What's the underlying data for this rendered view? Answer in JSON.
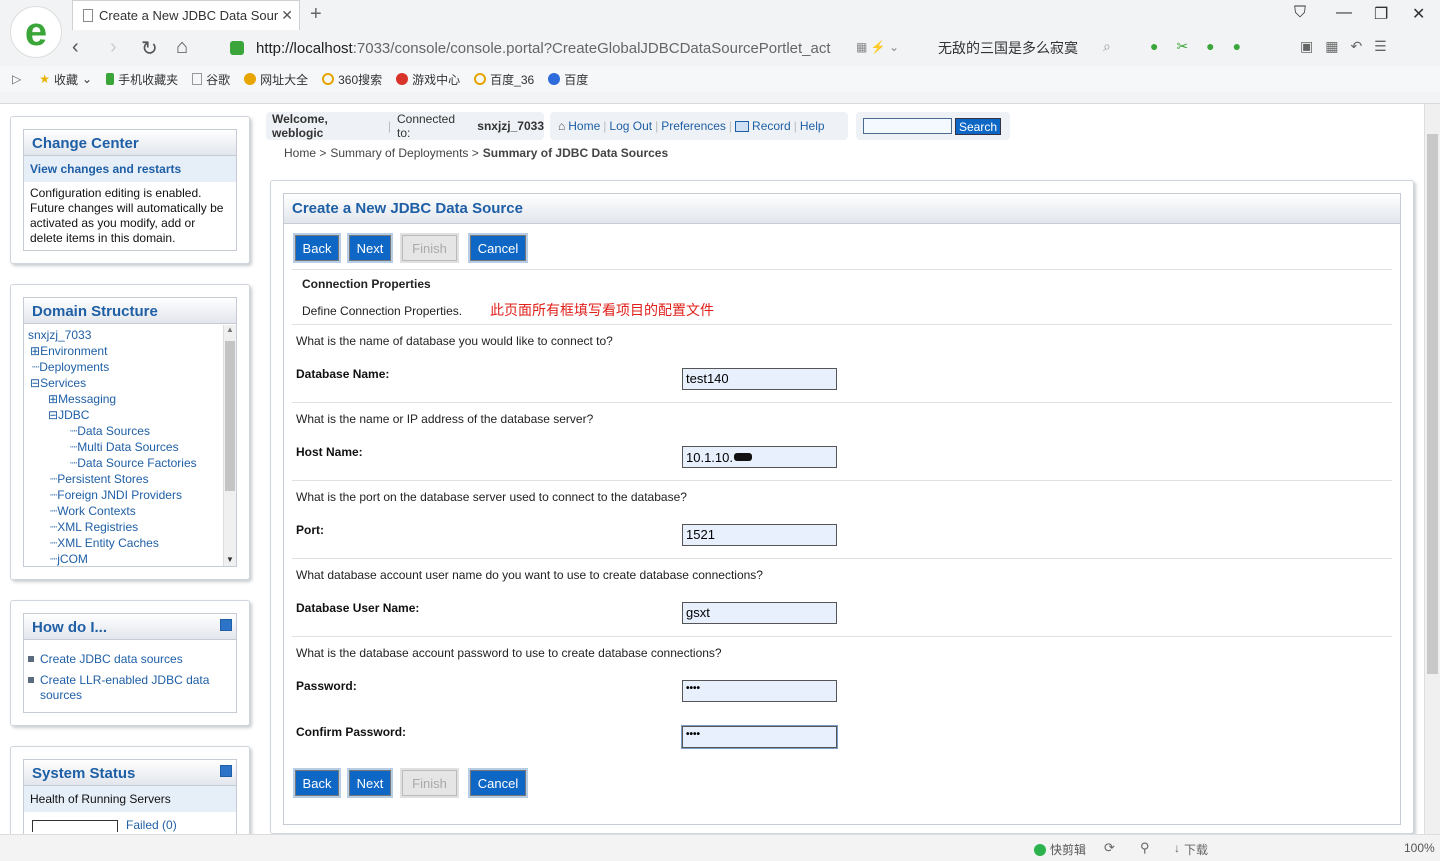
{
  "browser": {
    "tab_title": "Create a New JDBC Data Sour",
    "url_host": "http://localhost",
    "url_rest": ":7033/console/console.portal?CreateGlobalJDBCDataSourcePortlet_act",
    "search_text": "无敌的三国是多么寂寞",
    "bookmarks": [
      "收藏",
      "手机收藏夹",
      "谷歌",
      "网址大全",
      "360搜索",
      "游戏中心",
      "百度_36",
      "百度"
    ]
  },
  "header": {
    "welcome": "Welcome, weblogic",
    "connected_label": "Connected to:",
    "connected_value": "snxjzj_7033",
    "links": [
      "Home",
      "Log Out",
      "Preferences",
      "Record",
      "Help"
    ],
    "search_button": "Search",
    "search_value": ""
  },
  "breadcrumb": {
    "items": [
      "Home >",
      "Summary of Deployments >"
    ],
    "current": "Summary of JDBC Data Sources"
  },
  "change_center": {
    "title": "Change Center",
    "link": "View changes and restarts",
    "text": "Configuration editing is enabled. Future changes will automatically be activated as you modify, add or delete items in this domain."
  },
  "domain_structure": {
    "title": "Domain Structure",
    "items": [
      "snxjzj_7033",
      "Environment",
      "Deployments",
      "Services",
      "Messaging",
      "JDBC",
      "Data Sources",
      "Multi Data Sources",
      "Data Source Factories",
      "Persistent Stores",
      "Foreign JNDI Providers",
      "Work Contexts",
      "XML Registries",
      "XML Entity Caches",
      "jCOM"
    ]
  },
  "how_do_i": {
    "title": "How do I...",
    "items": [
      "Create JDBC data sources",
      "Create LLR-enabled JDBC data sources"
    ]
  },
  "system_status": {
    "title": "System Status",
    "subtitle": "Health of Running Servers",
    "failed": "Failed (0)"
  },
  "form": {
    "title": "Create a New JDBC Data Source",
    "buttons": {
      "back": "Back",
      "next": "Next",
      "finish": "Finish",
      "cancel": "Cancel"
    },
    "section_title": "Connection Properties",
    "section_desc": "Define Connection Properties.",
    "annotation": "此页面所有框填写看项目的配置文件",
    "q_dbname": "What is the name of database you would like to connect to?",
    "l_dbname": "Database Name:",
    "v_dbname": "test140",
    "q_host": "What is the name or IP address of the database server?",
    "l_host": "Host Name:",
    "v_host": "10.1.10.",
    "q_port": "What is the port on the database server used to connect to the database?",
    "l_port": "Port:",
    "v_port": "1521",
    "q_user": "What database account user name do you want to use to create database connections?",
    "l_user": "Database User Name:",
    "v_user": "gsxt",
    "q_pass": "What is the database account password to use to create database connections?",
    "l_pass": "Password:",
    "v_pass": "••••",
    "l_confirm": "Confirm Password:",
    "v_confirm": "••••"
  },
  "statusbar": {
    "kuaijian": "快剪辑",
    "download": "下载",
    "zoom": "100%"
  }
}
